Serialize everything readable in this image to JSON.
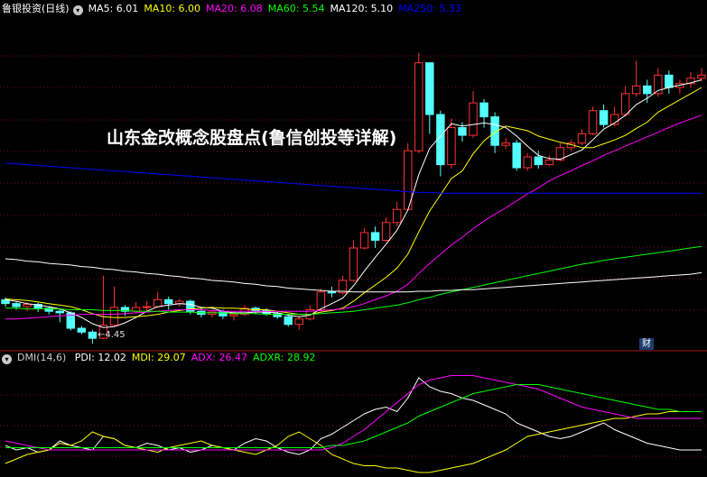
{
  "header": {
    "stock_name": "鲁银投资(日线)",
    "ma": [
      {
        "label": "MA5",
        "value": "6.01",
        "color": "#ffffff"
      },
      {
        "label": "MA10",
        "value": "6.00",
        "color": "#ffff00"
      },
      {
        "label": "MA20",
        "value": "6.08",
        "color": "#ff00ff"
      },
      {
        "label": "MA60",
        "value": "5.54",
        "color": "#00ff00"
      },
      {
        "label": "MA120",
        "value": "5.10",
        "color": "#ffffff"
      },
      {
        "label": "MA250",
        "value": "5.33",
        "color": "#0000ff"
      }
    ]
  },
  "overlay_title": "山东金改概念股盘点(鲁信创投等详解)",
  "low_label": "4.45",
  "badge": "财",
  "dmi": {
    "name": "DMI(14,6)",
    "items": [
      {
        "label": "PDI",
        "value": "12.02",
        "color": "#ffffff"
      },
      {
        "label": "MDI",
        "value": "29.07",
        "color": "#ffff00"
      },
      {
        "label": "ADX",
        "value": "26.47",
        "color": "#ff00ff"
      },
      {
        "label": "ADXR",
        "value": "28.92",
        "color": "#00ff00"
      }
    ]
  },
  "chart_data": [
    {
      "type": "candlestick",
      "title": "鲁银投资(日线)",
      "ylim": [
        4.3,
        8.6
      ],
      "colors": {
        "up": "#ff3232",
        "down": "#54ffff"
      },
      "candles": [
        [
          4.95,
          4.9,
          4.98,
          4.86
        ],
        [
          4.9,
          4.86,
          4.93,
          4.82
        ],
        [
          4.86,
          4.89,
          4.92,
          4.8
        ],
        [
          4.89,
          4.84,
          4.91,
          4.79
        ],
        [
          4.84,
          4.8,
          4.86,
          4.76
        ],
        [
          4.8,
          4.78,
          4.84,
          4.66
        ],
        [
          4.78,
          4.58,
          4.8,
          4.55
        ],
        [
          4.58,
          4.53,
          4.61,
          4.5
        ],
        [
          4.53,
          4.45,
          4.56,
          4.38
        ],
        [
          4.45,
          4.62,
          5.26,
          4.44
        ],
        [
          4.62,
          4.85,
          5.12,
          4.6
        ],
        [
          4.85,
          4.8,
          4.88,
          4.74
        ],
        [
          4.8,
          4.85,
          4.92,
          4.78
        ],
        [
          4.85,
          4.86,
          4.93,
          4.8
        ],
        [
          4.86,
          4.95,
          5.05,
          4.84
        ],
        [
          4.95,
          4.9,
          4.99,
          4.82
        ],
        [
          4.9,
          4.93,
          4.96,
          4.86
        ],
        [
          4.93,
          4.8,
          4.95,
          4.76
        ],
        [
          4.8,
          4.76,
          4.84,
          4.72
        ],
        [
          4.76,
          4.79,
          4.82,
          4.72
        ],
        [
          4.79,
          4.74,
          4.82,
          4.7
        ],
        [
          4.74,
          4.76,
          4.8,
          4.68
        ],
        [
          4.76,
          4.84,
          4.88,
          4.74
        ],
        [
          4.84,
          4.81,
          4.86,
          4.76
        ],
        [
          4.81,
          4.77,
          4.84,
          4.74
        ],
        [
          4.77,
          4.73,
          4.8,
          4.7
        ],
        [
          4.73,
          4.63,
          4.76,
          4.6
        ],
        [
          4.63,
          4.7,
          4.74,
          4.56
        ],
        [
          4.7,
          4.82,
          4.88,
          4.68
        ],
        [
          4.82,
          5.05,
          5.09,
          4.8
        ],
        [
          5.05,
          5.04,
          5.12,
          4.98
        ],
        [
          5.04,
          5.2,
          5.26,
          5.02
        ],
        [
          5.2,
          5.62,
          5.72,
          5.18
        ],
        [
          5.62,
          5.82,
          5.88,
          5.6
        ],
        [
          5.82,
          5.72,
          5.9,
          5.62
        ],
        [
          5.72,
          5.95,
          6.02,
          5.7
        ],
        [
          5.95,
          6.12,
          6.22,
          5.9
        ],
        [
          6.12,
          6.88,
          6.98,
          6.1
        ],
        [
          6.88,
          8.02,
          8.15,
          6.85
        ],
        [
          8.02,
          7.35,
          7.5,
          7.1
        ],
        [
          7.35,
          6.7,
          7.4,
          6.55
        ],
        [
          6.7,
          7.18,
          7.3,
          6.65
        ],
        [
          7.18,
          7.08,
          7.25,
          7.0
        ],
        [
          7.08,
          7.5,
          7.65,
          7.05
        ],
        [
          7.5,
          7.32,
          7.55,
          7.18
        ],
        [
          7.32,
          6.95,
          7.38,
          6.85
        ],
        [
          6.95,
          6.98,
          7.05,
          6.9
        ],
        [
          6.98,
          6.66,
          7.02,
          6.62
        ],
        [
          6.66,
          6.8,
          6.85,
          6.62
        ],
        [
          6.8,
          6.7,
          6.88,
          6.65
        ],
        [
          6.7,
          6.76,
          6.82,
          6.68
        ],
        [
          6.76,
          6.92,
          6.98,
          6.74
        ],
        [
          6.92,
          6.98,
          7.02,
          6.88
        ],
        [
          6.98,
          7.1,
          7.16,
          6.95
        ],
        [
          7.1,
          7.4,
          7.45,
          7.08
        ],
        [
          7.4,
          7.22,
          7.48,
          7.18
        ],
        [
          7.22,
          7.35,
          7.45,
          7.2
        ],
        [
          7.35,
          7.62,
          7.72,
          7.32
        ],
        [
          7.62,
          7.72,
          8.05,
          7.58
        ],
        [
          7.72,
          7.62,
          7.8,
          7.5
        ],
        [
          7.62,
          7.86,
          7.95,
          7.58
        ],
        [
          7.86,
          7.7,
          7.92,
          7.62
        ],
        [
          7.7,
          7.75,
          7.8,
          7.62
        ],
        [
          7.75,
          7.82,
          7.9,
          7.7
        ],
        [
          7.82,
          7.86,
          7.95,
          7.78
        ]
      ],
      "series": [
        {
          "name": "MA5",
          "color": "#ffffff",
          "values": [
            4.95,
            4.93,
            4.9,
            4.88,
            4.86,
            4.83,
            4.78,
            4.72,
            4.64,
            4.59,
            4.6,
            4.65,
            4.72,
            4.8,
            4.86,
            4.88,
            4.9,
            4.89,
            4.85,
            4.84,
            4.8,
            4.78,
            4.78,
            4.79,
            4.79,
            4.78,
            4.75,
            4.73,
            4.75,
            4.83,
            4.9,
            4.97,
            5.13,
            5.32,
            5.5,
            5.67,
            5.85,
            6.11,
            6.57,
            6.91,
            7.07,
            7.23,
            7.2,
            7.22,
            7.24,
            7.22,
            7.18,
            7.07,
            6.94,
            6.82,
            6.78,
            6.77,
            6.83,
            6.89,
            7.02,
            7.16,
            7.24,
            7.34,
            7.48,
            7.56,
            7.66,
            7.7,
            7.73,
            7.76,
            7.8
          ]
        },
        {
          "name": "MA10",
          "color": "#ffff00",
          "values": [
            4.96,
            4.95,
            4.94,
            4.92,
            4.9,
            4.88,
            4.86,
            4.82,
            4.77,
            4.73,
            4.72,
            4.72,
            4.73,
            4.74,
            4.76,
            4.79,
            4.81,
            4.83,
            4.84,
            4.85,
            4.84,
            4.84,
            4.83,
            4.82,
            4.82,
            4.8,
            4.78,
            4.76,
            4.76,
            4.79,
            4.81,
            4.84,
            4.93,
            5.04,
            5.14,
            5.24,
            5.36,
            5.54,
            5.83,
            6.1,
            6.31,
            6.52,
            6.62,
            6.84,
            7.01,
            7.12,
            7.2,
            7.17,
            7.14,
            7.07,
            7.03,
            6.99,
            6.96,
            6.92,
            6.92,
            6.97,
            7.02,
            7.08,
            7.17,
            7.25,
            7.38,
            7.46,
            7.54,
            7.62,
            7.7
          ]
        },
        {
          "name": "MA20",
          "color": "#ff00ff",
          "values": [
            4.7,
            4.7,
            4.71,
            4.72,
            4.73,
            4.74,
            4.75,
            4.76,
            4.76,
            4.76,
            4.76,
            4.77,
            4.78,
            4.79,
            4.8,
            4.81,
            4.82,
            4.82,
            4.82,
            4.81,
            4.8,
            4.8,
            4.8,
            4.8,
            4.8,
            4.8,
            4.8,
            4.8,
            4.8,
            4.81,
            4.82,
            4.83,
            4.86,
            4.9,
            4.95,
            5.0,
            5.06,
            5.15,
            5.29,
            5.42,
            5.54,
            5.66,
            5.76,
            5.87,
            5.97,
            6.06,
            6.14,
            6.23,
            6.32,
            6.4,
            6.49,
            6.56,
            6.62,
            6.69,
            6.75,
            6.82,
            6.88,
            6.94,
            7.0,
            7.06,
            7.12,
            7.18,
            7.24,
            7.29,
            7.34
          ]
        },
        {
          "name": "MA60",
          "color": "#00ff00",
          "values": [
            4.84,
            4.84,
            4.83,
            4.83,
            4.83,
            4.83,
            4.82,
            4.82,
            4.82,
            4.81,
            4.81,
            4.81,
            4.8,
            4.8,
            4.8,
            4.79,
            4.79,
            4.79,
            4.78,
            4.78,
            4.78,
            4.77,
            4.77,
            4.77,
            4.76,
            4.76,
            4.76,
            4.76,
            4.76,
            4.77,
            4.78,
            4.79,
            4.8,
            4.82,
            4.84,
            4.86,
            4.88,
            4.91,
            4.95,
            4.98,
            5.02,
            5.05,
            5.08,
            5.11,
            5.14,
            5.17,
            5.2,
            5.23,
            5.26,
            5.29,
            5.32,
            5.35,
            5.38,
            5.41,
            5.43,
            5.46,
            5.48,
            5.5,
            5.52,
            5.54,
            5.56,
            5.58,
            5.6,
            5.62,
            5.64
          ]
        },
        {
          "name": "MA120",
          "color": "#ffffff",
          "values": [
            5.48,
            5.47,
            5.45,
            5.44,
            5.42,
            5.41,
            5.4,
            5.38,
            5.37,
            5.35,
            5.34,
            5.32,
            5.31,
            5.29,
            5.28,
            5.26,
            5.25,
            5.23,
            5.22,
            5.2,
            5.19,
            5.18,
            5.16,
            5.15,
            5.13,
            5.12,
            5.1,
            5.09,
            5.08,
            5.07,
            5.06,
            5.06,
            5.05,
            5.05,
            5.05,
            5.05,
            5.05,
            5.05,
            5.06,
            5.06,
            5.07,
            5.07,
            5.08,
            5.08,
            5.09,
            5.1,
            5.11,
            5.12,
            5.13,
            5.14,
            5.15,
            5.16,
            5.17,
            5.18,
            5.19,
            5.2,
            5.21,
            5.22,
            5.23,
            5.24,
            5.25,
            5.26,
            5.27,
            5.28,
            5.3
          ]
        },
        {
          "name": "MA250",
          "color": "#0000ff",
          "values": [
            6.72,
            6.71,
            6.7,
            6.69,
            6.68,
            6.67,
            6.66,
            6.65,
            6.64,
            6.63,
            6.62,
            6.61,
            6.6,
            6.59,
            6.58,
            6.57,
            6.56,
            6.55,
            6.54,
            6.53,
            6.52,
            6.51,
            6.5,
            6.49,
            6.48,
            6.47,
            6.46,
            6.45,
            6.44,
            6.43,
            6.42,
            6.41,
            6.4,
            6.39,
            6.38,
            6.37,
            6.36,
            6.35,
            6.34,
            6.34,
            6.33,
            6.33,
            6.33,
            6.33,
            6.33,
            6.33,
            6.33,
            6.33,
            6.33,
            6.33,
            6.33,
            6.33,
            6.33,
            6.33,
            6.33,
            6.33,
            6.33,
            6.33,
            6.33,
            6.33,
            6.33,
            6.33,
            6.33,
            6.33,
            6.33
          ]
        }
      ]
    },
    {
      "type": "line",
      "title": "DMI(14,6)",
      "ylim": [
        0,
        50
      ],
      "series": [
        {
          "name": "PDI",
          "color": "#ffffff",
          "values": [
            14,
            12,
            13,
            11,
            12,
            16,
            14,
            13,
            12,
            18,
            17,
            14,
            13,
            15,
            14,
            12,
            13,
            11,
            12,
            14,
            13,
            12,
            15,
            17,
            16,
            13,
            11,
            10,
            12,
            17,
            19,
            22,
            25,
            28,
            30,
            31,
            29,
            35,
            44,
            40,
            38,
            37,
            35,
            34,
            32,
            30,
            28,
            24,
            22,
            20,
            18,
            17,
            18,
            20,
            22,
            24,
            21,
            19,
            17,
            15,
            14,
            13,
            12,
            12,
            12
          ]
        },
        {
          "name": "MDI",
          "color": "#ffff00",
          "values": [
            6,
            8,
            10,
            11,
            12,
            15,
            14,
            16,
            20,
            18,
            17,
            14,
            13,
            12,
            11,
            13,
            14,
            15,
            16,
            14,
            13,
            12,
            11,
            10,
            12,
            14,
            18,
            20,
            17,
            14,
            10,
            8,
            6,
            5,
            5,
            4,
            4,
            3,
            2,
            2,
            3,
            4,
            5,
            6,
            8,
            10,
            12,
            15,
            18,
            19,
            20,
            21,
            22,
            23,
            24,
            25,
            26,
            26,
            27,
            28,
            28,
            29,
            29,
            29,
            29
          ]
        },
        {
          "name": "ADX",
          "color": "#ff00ff",
          "values": [
            16,
            15,
            14,
            13,
            12,
            12,
            12,
            12,
            12,
            12,
            12,
            12,
            12,
            12,
            12,
            12,
            12,
            12,
            12,
            12,
            12,
            12,
            12,
            12,
            12,
            12,
            12,
            12,
            12,
            12,
            13,
            15,
            18,
            21,
            25,
            29,
            33,
            37,
            41,
            43,
            44,
            45,
            45,
            45,
            44,
            43,
            42,
            41,
            40,
            39,
            37,
            35,
            33,
            31,
            30,
            29,
            28,
            27,
            26,
            26,
            26,
            26,
            26,
            26,
            26
          ]
        },
        {
          "name": "ADXR",
          "color": "#00ff00",
          "values": [
            13,
            13,
            13,
            13,
            13,
            13,
            13,
            13,
            13,
            13,
            13,
            13,
            13,
            13,
            13,
            13,
            13,
            13,
            13,
            13,
            13,
            13,
            13,
            13,
            13,
            13,
            13,
            13,
            13,
            13,
            14,
            14,
            15,
            16,
            18,
            20,
            22,
            24,
            27,
            29,
            31,
            33,
            35,
            37,
            38,
            39,
            40,
            41,
            41,
            41,
            40,
            39,
            38,
            37,
            36,
            35,
            34,
            33,
            32,
            31,
            30,
            30,
            29,
            29,
            29
          ]
        }
      ]
    }
  ]
}
